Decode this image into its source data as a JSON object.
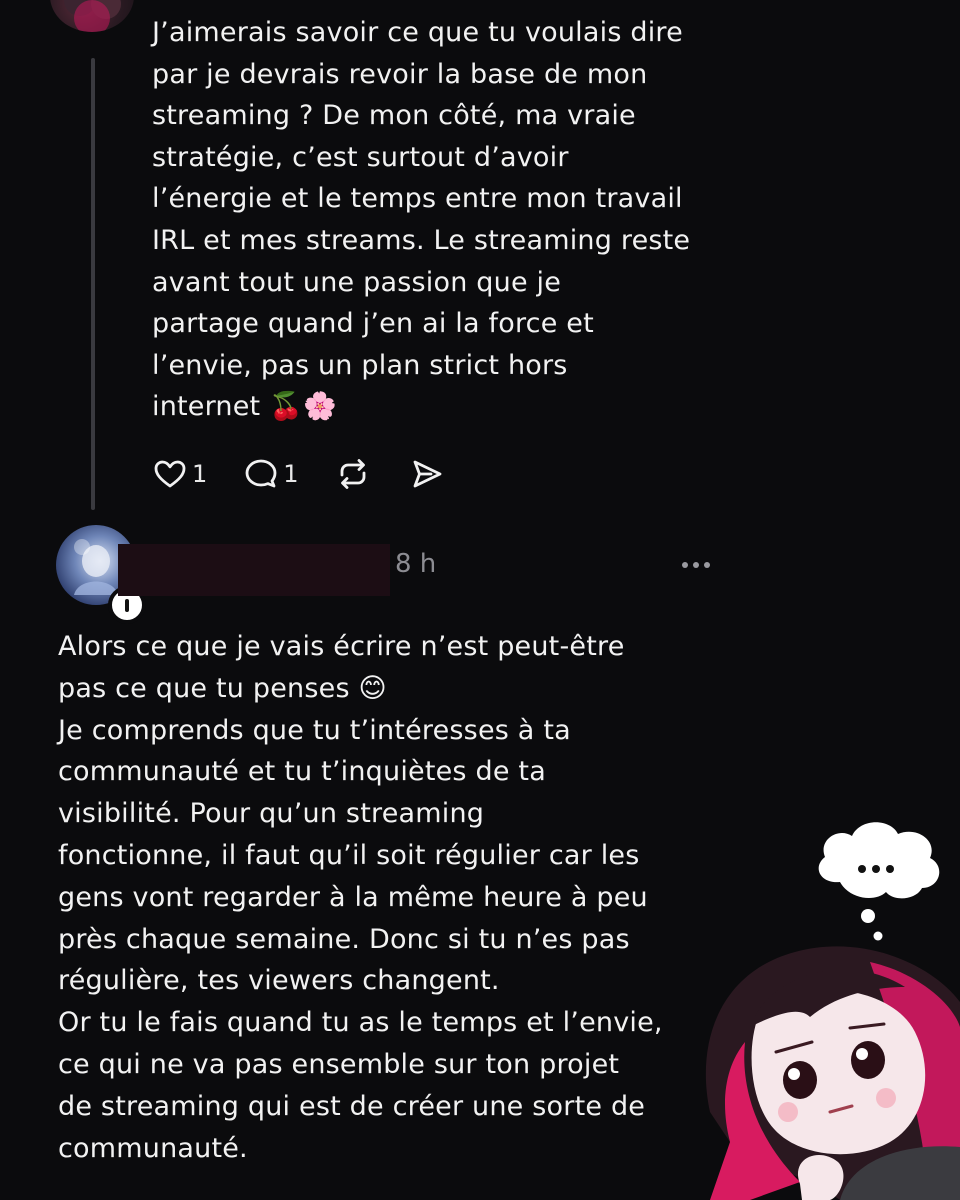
{
  "reply_post": {
    "text": "J’aimerais savoir ce que tu voulais dire\npar je devrais revoir la base de mon\nstreaming ? De mon côté, ma vraie\nstratégie, c’est surtout d’avoir\nl’énergie et le temps entre mon travail\nIRL et mes streams. Le streaming reste\navant tout une passion que je\npartage quand j’en ai la force et\nl’envie, pas un plan strict hors\ninternet 🍒🌸",
    "like_count": "1",
    "reply_count": "1",
    "icons": {
      "like": "heart-icon",
      "reply": "comment-icon",
      "repost": "repost-icon",
      "share": "send-icon"
    }
  },
  "post": {
    "timestamp": "8 h",
    "text": "Alors ce que je vais écrire n’est peut-être\npas ce que tu penses 😊\nJe comprends que tu t’intéresses à ta\ncommunauté et tu t’inquiètes de ta\nvisibilité. Pour qu’un streaming\nfonctionne, il faut qu’il soit régulier car les\ngens vont regarder à la même heure à peu\nprès chaque semaine. Donc si tu n’es pas\nrégulière, tes viewers changent.\nOr tu le fais quand tu as le temps et l’envie,\nce qui ne va pas ensemble sur ton projet\nde streaming qui est de créer une sorte de\ncommunauté.",
    "icons": {
      "more": "more-dots-icon",
      "follow": "follow-plus-icon"
    }
  },
  "colors": {
    "background": "#0b0b0d",
    "text": "#f2f2f2",
    "muted": "#8c8c92",
    "thread_line": "#3a3a3f"
  }
}
